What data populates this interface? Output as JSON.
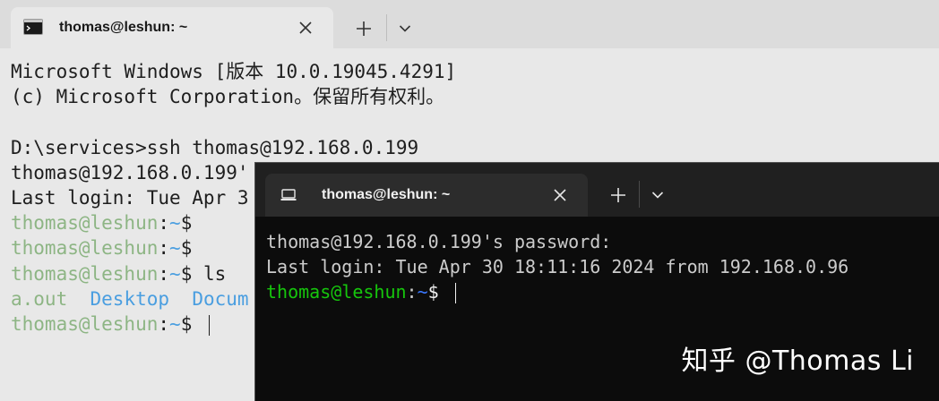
{
  "back_window": {
    "tab_title": "thomas@leshun: ~",
    "lines": [
      {
        "segments": [
          {
            "text": "Microsoft Windows [版本 10.0.19045.4291]",
            "color": "default"
          }
        ]
      },
      {
        "segments": [
          {
            "text": "(c) Microsoft Corporation。保留所有权利。",
            "color": "default"
          }
        ]
      },
      {
        "segments": [
          {
            "text": "",
            "color": "default"
          }
        ]
      },
      {
        "segments": [
          {
            "text": "D:\\services>ssh thomas@192.168.0.199",
            "color": "default"
          }
        ]
      },
      {
        "segments": [
          {
            "text": "thomas@192.168.0.199'",
            "color": "default"
          }
        ]
      },
      {
        "segments": [
          {
            "text": "Last login: Tue Apr 3",
            "color": "default"
          }
        ]
      },
      {
        "segments": [
          {
            "text": "thomas@leshun",
            "color": "green"
          },
          {
            "text": ":",
            "color": "default"
          },
          {
            "text": "~",
            "color": "blue"
          },
          {
            "text": "$",
            "color": "default"
          }
        ]
      },
      {
        "segments": [
          {
            "text": "thomas@leshun",
            "color": "green"
          },
          {
            "text": ":",
            "color": "default"
          },
          {
            "text": "~",
            "color": "blue"
          },
          {
            "text": "$",
            "color": "default"
          }
        ]
      },
      {
        "segments": [
          {
            "text": "thomas@leshun",
            "color": "green"
          },
          {
            "text": ":",
            "color": "default"
          },
          {
            "text": "~",
            "color": "blue"
          },
          {
            "text": "$ ls",
            "color": "default"
          }
        ]
      },
      {
        "segments": [
          {
            "text": "a.out",
            "color": "green"
          },
          {
            "text": "  ",
            "color": "default"
          },
          {
            "text": "Desktop",
            "color": "blue"
          },
          {
            "text": "  ",
            "color": "default"
          },
          {
            "text": "Docum",
            "color": "blue"
          }
        ]
      },
      {
        "segments": [
          {
            "text": "thomas@leshun",
            "color": "green"
          },
          {
            "text": ":",
            "color": "default"
          },
          {
            "text": "~",
            "color": "blue"
          },
          {
            "text": "$ ",
            "color": "default"
          }
        ],
        "cursor": true
      }
    ]
  },
  "front_window": {
    "tab_title": "thomas@leshun: ~",
    "lines": [
      {
        "segments": [
          {
            "text": "thomas@192.168.0.199's password:",
            "color": "default"
          }
        ]
      },
      {
        "segments": [
          {
            "text": "Last login: Tue Apr 30 18:11:16 2024 from 192.168.0.96",
            "color": "default"
          }
        ]
      },
      {
        "segments": [
          {
            "text": "thomas@leshun",
            "color": "green"
          },
          {
            "text": ":",
            "color": "default"
          },
          {
            "text": "~",
            "color": "blue"
          },
          {
            "text": "$ ",
            "color": "white"
          }
        ],
        "cursor": true
      }
    ]
  },
  "watermark": "知乎 @Thomas Li",
  "colors": {
    "back_default": "#1e1e1e",
    "back_green": "#8db584",
    "back_blue": "#4a9ee0",
    "front_default": "#cccccc",
    "front_green": "#16c60c",
    "front_blue": "#3b78ff",
    "front_white": "#f2f2f2"
  },
  "icons": [
    "terminal-icon",
    "close-icon",
    "plus-icon",
    "chevron-down-icon"
  ]
}
